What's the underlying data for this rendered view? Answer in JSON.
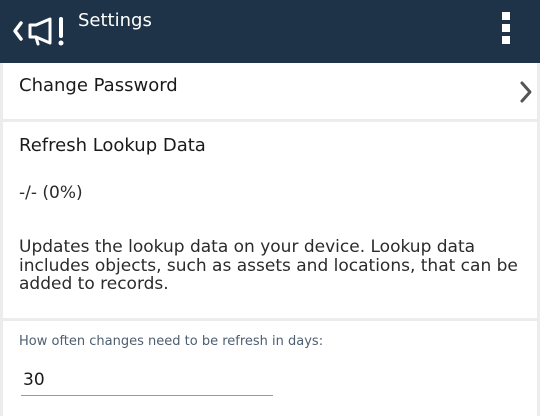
{
  "app_bar": {
    "title": "Settings",
    "back_icon": "chevron-left-icon",
    "app_icon": "megaphone-icon",
    "menu_icon": "kebab-menu-icon",
    "color": "#1e3347"
  },
  "change_password": {
    "label": "Change Password",
    "icon": "chevron-right-icon"
  },
  "refresh_lookup": {
    "title": "Refresh Lookup Data",
    "progress": "-/- (0%)",
    "description": "Updates the lookup data on your device. Lookup data includes objects, such as assets and locations, that can be added to records."
  },
  "refresh_frequency": {
    "label": "How often changes need to be refresh in days:",
    "value": "30"
  }
}
